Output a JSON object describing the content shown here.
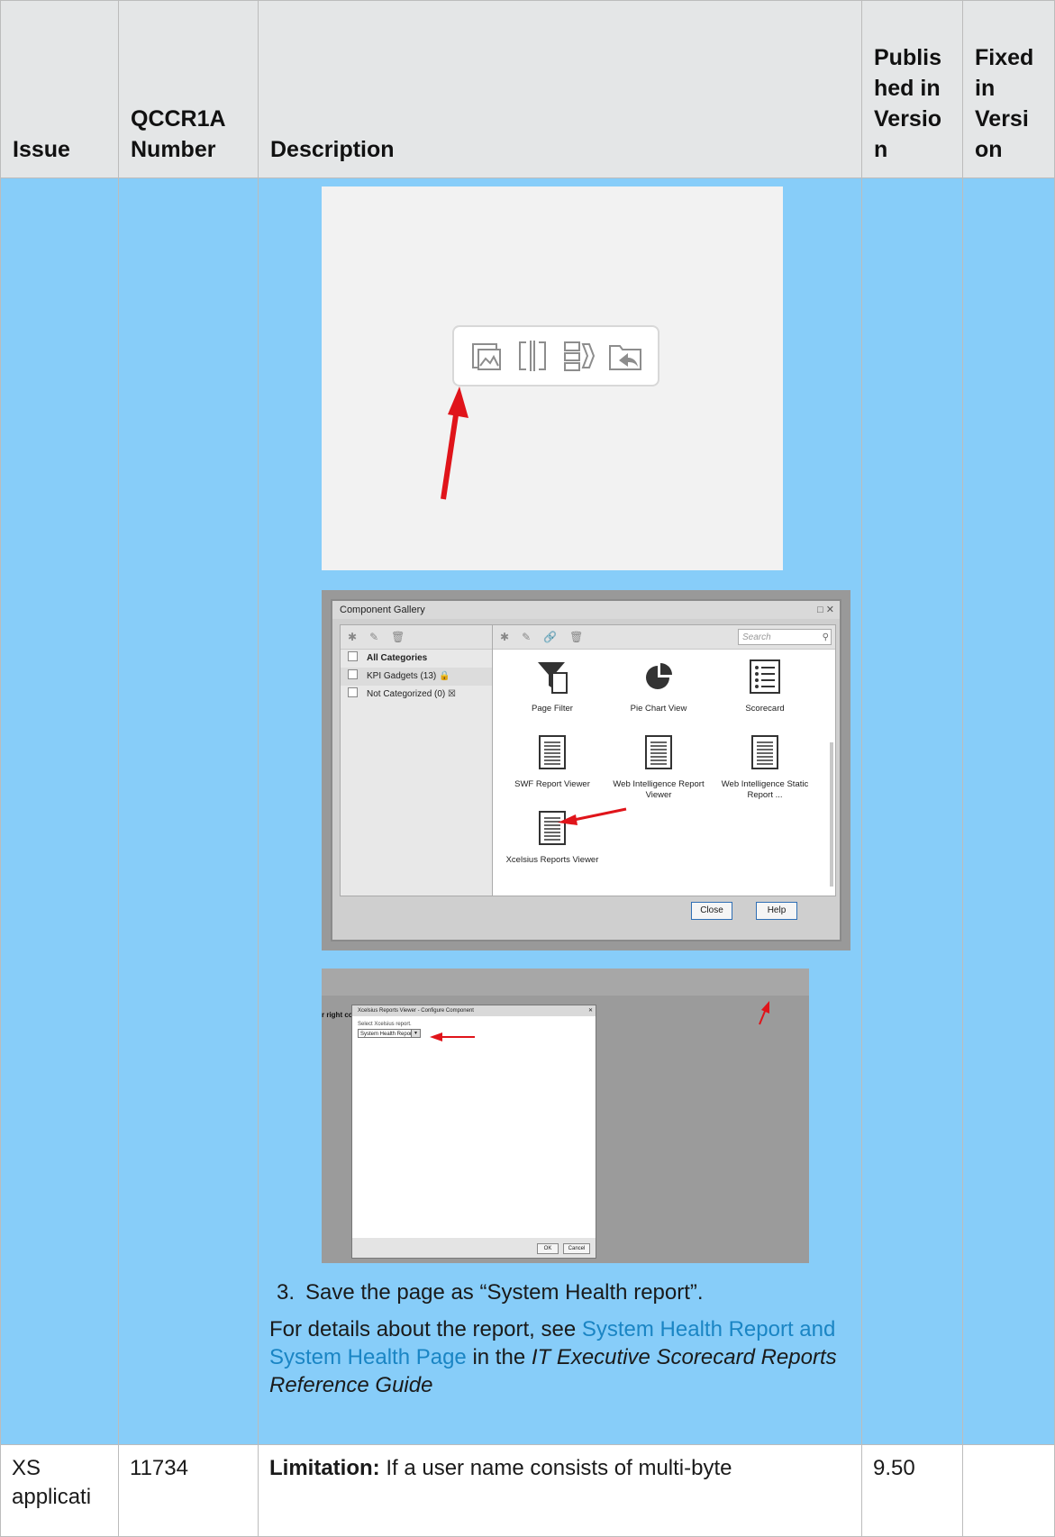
{
  "table": {
    "headers": {
      "issue": "Issue",
      "qccr": "QCCR1A Number",
      "description": "Description",
      "published": "Publis hed in Versio n",
      "fixed": "Fixed in Versi on"
    }
  },
  "gallery": {
    "title": "Component Gallery",
    "search_placeholder": "Search",
    "categories": [
      {
        "label": "All Categories"
      },
      {
        "label": "KPI Gadgets (13)"
      },
      {
        "label": "Not Categorized (0)"
      }
    ],
    "items": [
      {
        "label": "Page Filter",
        "icon": "funnel-icon"
      },
      {
        "label": "Pie Chart View",
        "icon": "pie-chart-icon"
      },
      {
        "label": "Scorecard",
        "icon": "scorecard-icon"
      },
      {
        "label": "SWF Report Viewer",
        "icon": "document-icon"
      },
      {
        "label": "Web Intelligence Report Viewer",
        "icon": "document-icon"
      },
      {
        "label": "Web Intelligence Static Report ...",
        "icon": "document-icon"
      },
      {
        "label": "Xcelsius Reports Viewer",
        "icon": "document-icon"
      }
    ],
    "close_label": "Close",
    "help_label": "Help"
  },
  "configure": {
    "right_corner_text": "r right corn",
    "title": "Xcelsius Reports Viewer - Configure Component",
    "select_label": "Select Xcelsius report.",
    "select_value": "System Health Report",
    "ok_label": "OK",
    "cancel_label": "Cancel"
  },
  "step3": {
    "number": "3.",
    "text": "Save the page as “System Health report”."
  },
  "details": {
    "prefix": "For details about the report, see ",
    "link": "System Health Report and System Health Page",
    "middle": " in the ",
    "guide": "IT Executive Scorecard Reports Reference Guide"
  },
  "row2": {
    "issue": "XS applicati",
    "number": "11734",
    "limitation_label": "Limitation:",
    "limitation_text": " If a user name consists of multi-byte",
    "published": "9.50",
    "fixed": ""
  },
  "colors": {
    "header_bg": "#e4e6e7",
    "row_highlight": "#87cdf9",
    "link": "#1a85c4",
    "arrow": "#e0141a"
  }
}
